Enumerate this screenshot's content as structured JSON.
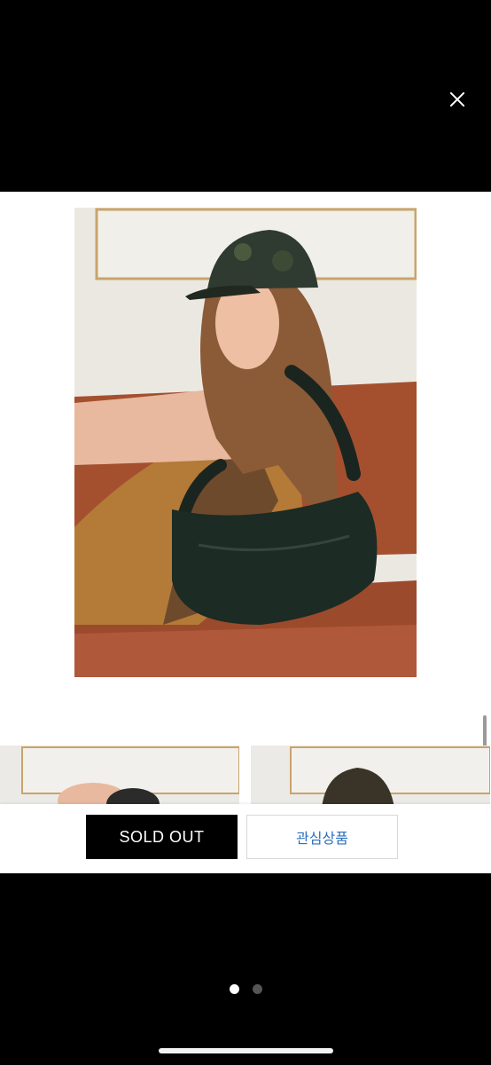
{
  "viewer": {
    "close_icon": "close-icon",
    "scroll_indicator": "vertical-scrollbar"
  },
  "product_image": {
    "description_icon": "product-photo",
    "thumbnails": [
      "product-thumbnail-1",
      "product-thumbnail-2"
    ]
  },
  "actions": {
    "soldout_label": "SOLD OUT",
    "wishlist_label": "관심상품"
  },
  "pager": {
    "total": 2,
    "active": 1
  },
  "colors": {
    "accent_link": "#2b6fbf",
    "background": "#000000",
    "sofa": "#a4502f",
    "bag": "#1c2b24"
  }
}
